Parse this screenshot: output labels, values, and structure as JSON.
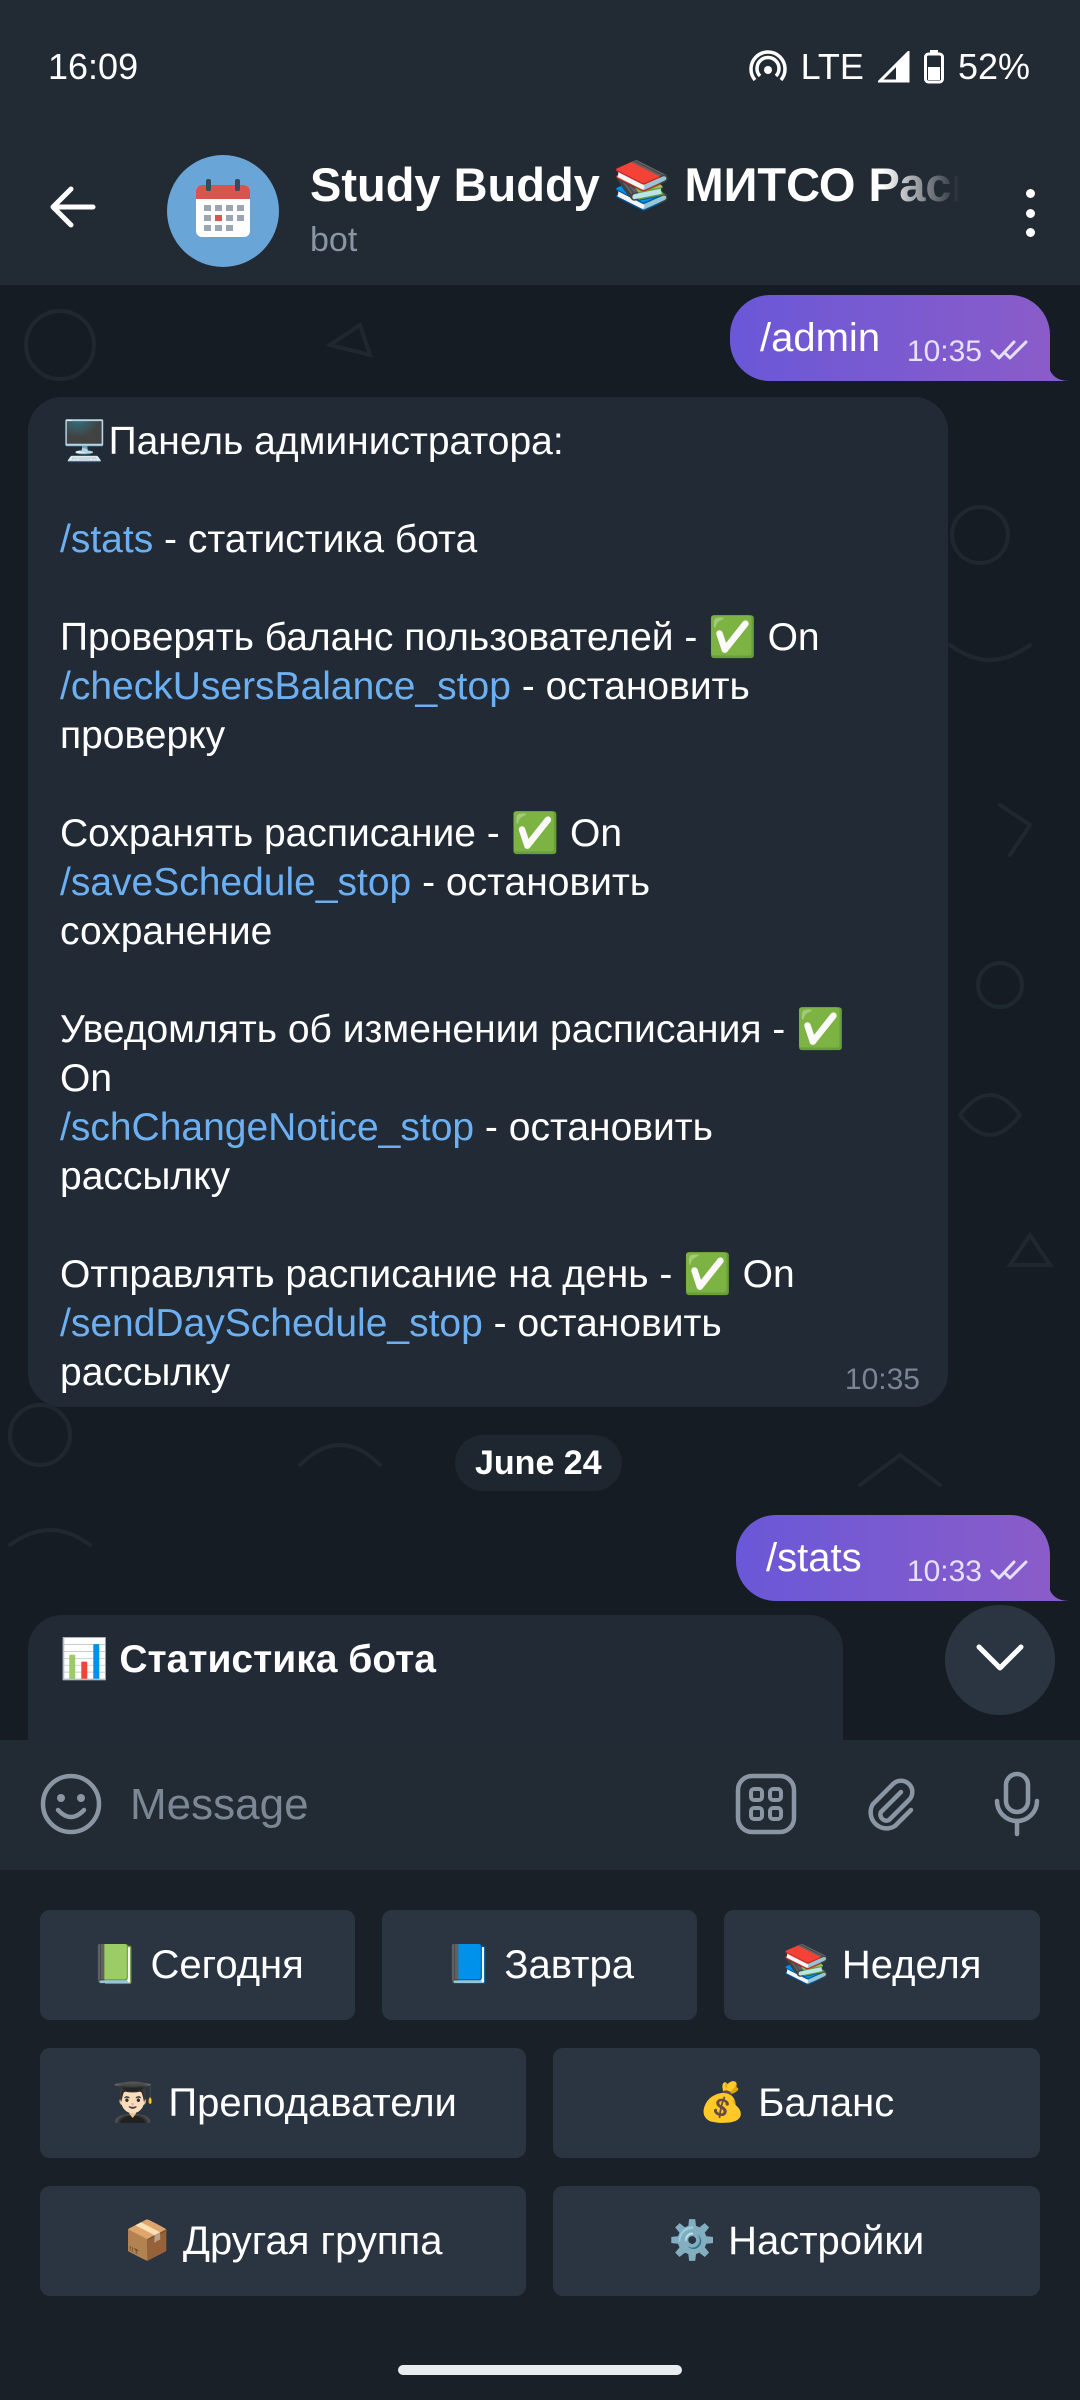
{
  "status_bar": {
    "time": "16:09",
    "network": "LTE",
    "battery": "52%"
  },
  "header": {
    "title": "Study Buddy 📚 МИТСО Расписание",
    "subtitle": "bot",
    "back_icon": "arrow-left-icon",
    "menu_icon": "more-vertical-icon",
    "avatar_icon": "calendar-icon"
  },
  "messages": {
    "admin_cmd": {
      "text": "/admin",
      "time": "10:35"
    },
    "admin_panel": {
      "title": "Панель администратора:",
      "stats_cmd": "/stats",
      "stats_desc": " - статистика бота",
      "check_balance": "Проверять баланс пользователей - ✅ On",
      "check_balance_cmd": "/checkUsersBalance_stop",
      "check_balance_desc": " - остановить",
      "check_balance_desc2": "проверку",
      "save_schedule": "Сохранять расписание - ✅ On",
      "save_schedule_cmd": "/saveSchedule_stop",
      "save_schedule_desc": " - остановить",
      "save_schedule_desc2": "сохранение",
      "notice": "Уведомлять об изменении расписания - ✅",
      "notice_on": "On",
      "notice_cmd": "/schChangeNotice_stop",
      "notice_desc": " - остановить",
      "notice_desc2": "рассылку",
      "day_schedule": "Отправлять расписание на день - ✅ On",
      "day_schedule_cmd": "/sendDaySchedule_stop",
      "day_schedule_desc": " - остановить",
      "day_schedule_desc2": "рассылку",
      "time": "10:35"
    },
    "date_separator": "June 24",
    "stats_cmd": {
      "text": "/stats",
      "time": "10:33"
    },
    "stats_reply": {
      "title": "📊 Статистика бота"
    }
  },
  "input": {
    "placeholder": "Message"
  },
  "keyboard": {
    "today": {
      "emoji": "📗",
      "label": "Сегодня"
    },
    "tomorrow": {
      "emoji": "📘",
      "label": "Завтра"
    },
    "week": {
      "emoji": "📚",
      "label": "Неделя"
    },
    "teachers": {
      "emoji": "👨🏻‍🎓",
      "label": "Преподаватели"
    },
    "balance": {
      "emoji": "💰",
      "label": "Баланс"
    },
    "other_group": {
      "emoji": "📦",
      "label": "Другая группа"
    },
    "settings": {
      "emoji": "⚙️",
      "label": "Настройки"
    }
  },
  "colors": {
    "accent": "#6cb0f2",
    "outgoing_bubble": "#7a5ad0",
    "incoming_bubble": "#222a35",
    "background": "#161c24"
  }
}
